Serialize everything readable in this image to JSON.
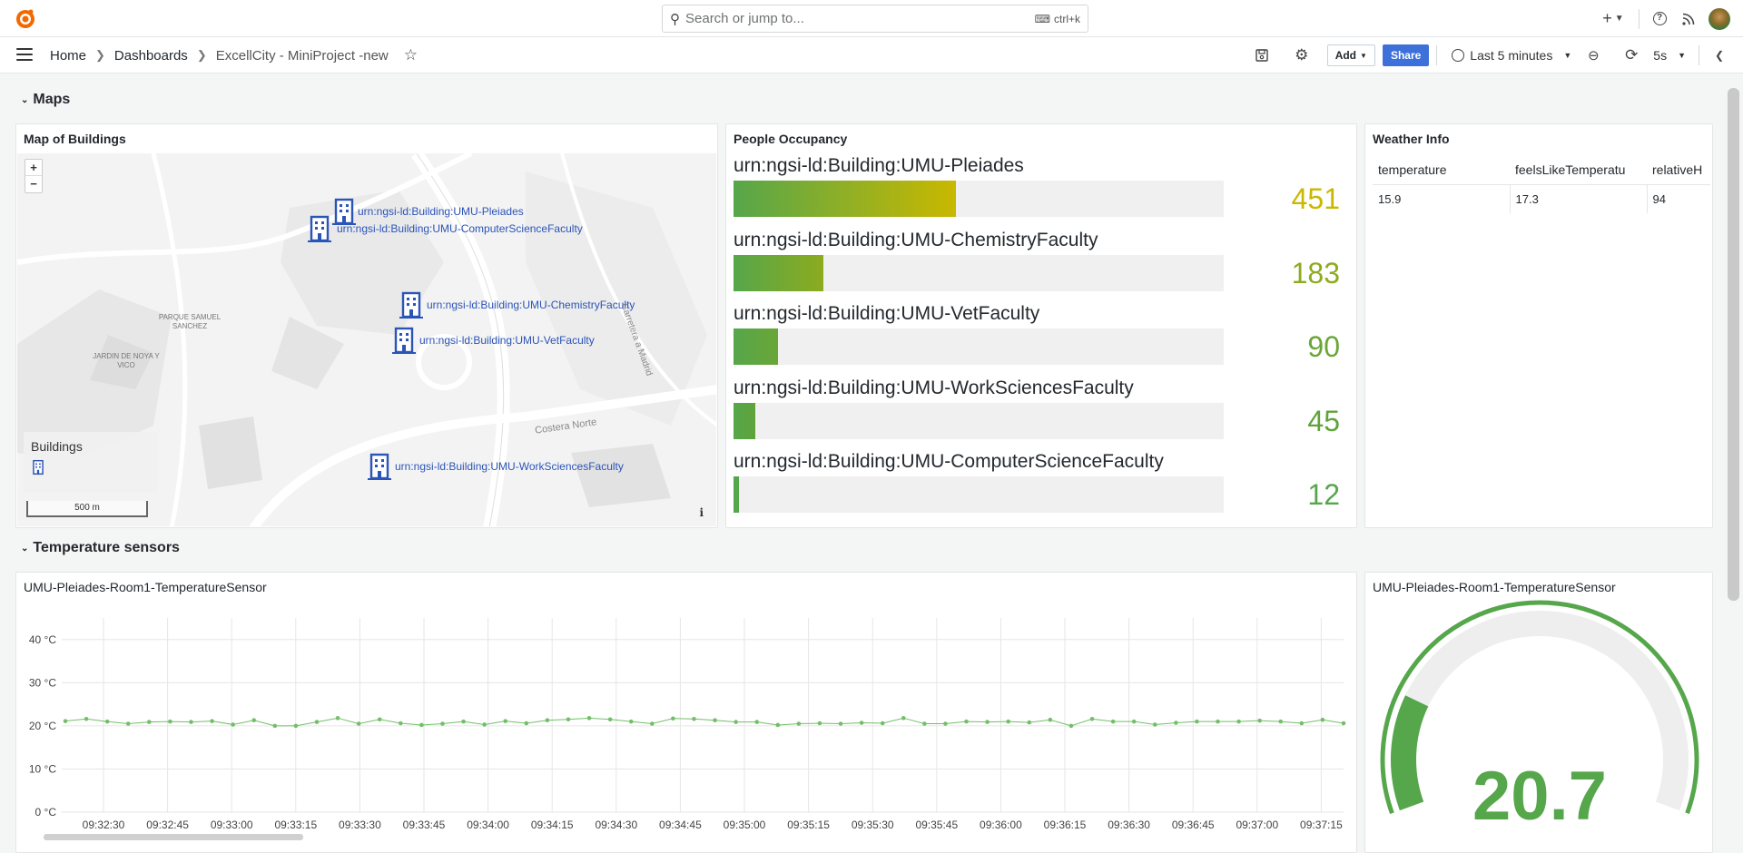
{
  "topbar": {
    "search_placeholder": "Search or jump to...",
    "search_shortcut": "ctrl+k",
    "icons": [
      "grafana-logo-icon",
      "plus-icon",
      "chevron-down-icon",
      "help-icon",
      "news-icon",
      "avatar"
    ]
  },
  "navbar": {
    "breadcrumbs": [
      "Home",
      "Dashboards",
      "ExcellCity - MiniProject -new"
    ],
    "add_label": "Add",
    "share_label": "Share",
    "time_range": "Last 5 minutes",
    "refresh_interval": "5s"
  },
  "rows": {
    "maps_title": "Maps",
    "temp_title": "Temperature sensors"
  },
  "map_panel": {
    "title": "Map of Buildings",
    "zoom_in": "+",
    "zoom_out": "−",
    "legend_title": "Buildings",
    "scale": "500 m",
    "info": "i",
    "place_labels": [
      "PARQUE SAMUEL SANCHEZ",
      "JARDIN DE NOYA Y VICO",
      "Costera Norte",
      "Carretera a Madrid"
    ],
    "markers": [
      {
        "label": "urn:ngsi-ld:Building:UMU-Pleiades"
      },
      {
        "label": "urn:ngsi-ld:Building:UMU-ComputerScienceFaculty"
      },
      {
        "label": "urn:ngsi-ld:Building:UMU-ChemistryFaculty"
      },
      {
        "label": "urn:ngsi-ld:Building:UMU-VetFaculty"
      },
      {
        "label": "urn:ngsi-ld:Building:UMU-WorkSciencesFaculty"
      }
    ]
  },
  "occupancy_panel": {
    "title": "People Occupancy",
    "max": 1100,
    "items": [
      {
        "name": "urn:ngsi-ld:Building:UMU-Pleiades",
        "value": "451",
        "fraction": 0.453,
        "color": "#c9b800"
      },
      {
        "name": "urn:ngsi-ld:Building:UMU-ChemistryFaculty",
        "value": "183",
        "fraction": 0.184,
        "color": "#8cab1f"
      },
      {
        "name": "urn:ngsi-ld:Building:UMU-VetFaculty",
        "value": "90",
        "fraction": 0.09,
        "color": "#6aa637"
      },
      {
        "name": "urn:ngsi-ld:Building:UMU-WorkSciencesFaculty",
        "value": "45",
        "fraction": 0.045,
        "color": "#5fa33a"
      },
      {
        "name": "urn:ngsi-ld:Building:UMU-ComputerScienceFaculty",
        "value": "12",
        "fraction": 0.012,
        "color": "#56a64b"
      }
    ]
  },
  "weather_panel": {
    "title": "Weather Info",
    "columns": [
      "temperature",
      "feelsLikeTemperatu",
      "relativeH"
    ],
    "row": [
      "15.9",
      "17.3",
      "94"
    ]
  },
  "ts_panel": {
    "title": "UMU-Pleiades-Room1-TemperatureSensor"
  },
  "gauge_panel": {
    "title": "UMU-Pleiades-Room1-TemperatureSensor",
    "value": "20.7",
    "fraction": 0.207,
    "color": "#56a64b"
  },
  "chart_data": {
    "type": "line",
    "title": "",
    "xlabel": "",
    "ylabel": "",
    "y_ticks": [
      "0 °C",
      "10 °C",
      "20 °C",
      "30 °C",
      "40 °C"
    ],
    "ylim": [
      0,
      45
    ],
    "x_ticks": [
      "09:32:30",
      "09:32:45",
      "09:33:00",
      "09:33:15",
      "09:33:30",
      "09:33:45",
      "09:34:00",
      "09:34:15",
      "09:34:30",
      "09:34:45",
      "09:35:00",
      "09:35:15",
      "09:35:30",
      "09:35:45",
      "09:36:00",
      "09:36:15",
      "09:36:30",
      "09:36:45",
      "09:37:00",
      "09:37:15"
    ],
    "grid": true,
    "series": [
      {
        "color": "#73bf69",
        "values": [
          21.1,
          21.6,
          21.0,
          20.5,
          20.9,
          21.0,
          20.9,
          21.1,
          20.3,
          21.3,
          20.0,
          20.0,
          20.9,
          21.8,
          20.5,
          21.5,
          20.6,
          20.2,
          20.5,
          21.0,
          20.3,
          21.1,
          20.6,
          21.3,
          21.5,
          21.8,
          21.5,
          21.0,
          20.5,
          21.7,
          21.6,
          21.3,
          20.9,
          20.9,
          20.2,
          20.5,
          20.6,
          20.5,
          20.7,
          20.6,
          21.8,
          20.5,
          20.5,
          21.0,
          20.9,
          21.0,
          20.8,
          21.4,
          20.0,
          21.6,
          21.0,
          21.0,
          20.3,
          20.7,
          21.0,
          21.0,
          21.0,
          21.2,
          21.0,
          20.6,
          21.4,
          20.6
        ]
      }
    ]
  }
}
